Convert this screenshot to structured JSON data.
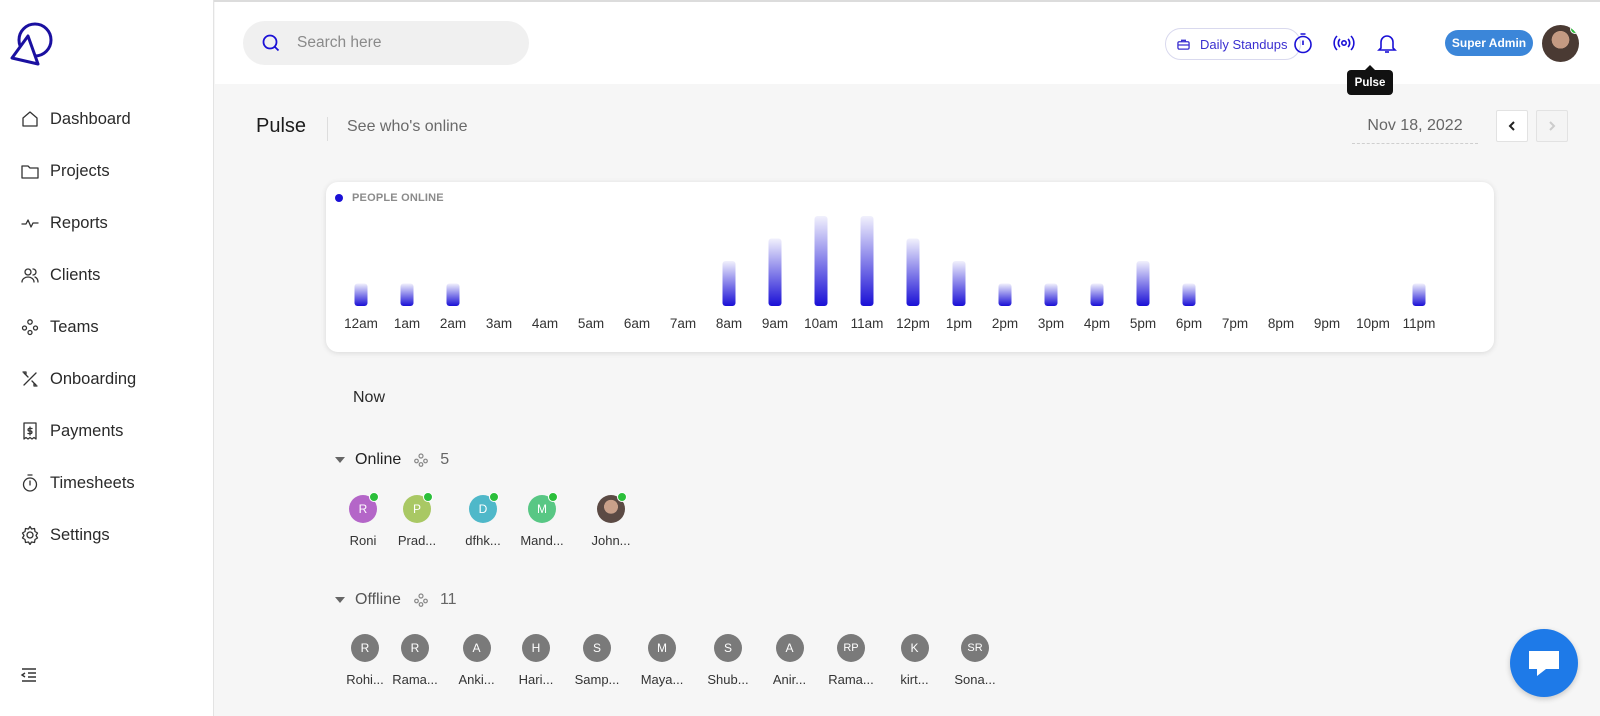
{
  "sidebar": {
    "items": [
      {
        "label": "Dashboard",
        "icon": "home-icon"
      },
      {
        "label": "Projects",
        "icon": "folder-icon"
      },
      {
        "label": "Reports",
        "icon": "activity-icon"
      },
      {
        "label": "Clients",
        "icon": "users-icon"
      },
      {
        "label": "Teams",
        "icon": "team-icon"
      },
      {
        "label": "Onboarding",
        "icon": "tools-icon"
      },
      {
        "label": "Payments",
        "icon": "invoice-icon"
      },
      {
        "label": "Timesheets",
        "icon": "stopwatch-icon"
      },
      {
        "label": "Settings",
        "icon": "gear-icon"
      }
    ]
  },
  "header": {
    "search_placeholder": "Search here",
    "standups_label": "Daily Standups",
    "tooltip": "Pulse",
    "role_badge": "Super Admin"
  },
  "page": {
    "title": "Pulse",
    "subtitle": "See who's online",
    "date": "Nov 18, 2022"
  },
  "colors": {
    "accent": "#1a10d6",
    "badge": "#3b86d9",
    "online": "#2bbf3a",
    "chat": "#1e7ae8"
  },
  "chart_data": {
    "type": "bar",
    "title": "PEOPLE ONLINE",
    "categories": [
      "12am",
      "1am",
      "2am",
      "3am",
      "4am",
      "5am",
      "6am",
      "7am",
      "8am",
      "9am",
      "10am",
      "11am",
      "12pm",
      "1pm",
      "2pm",
      "3pm",
      "4pm",
      "5pm",
      "6pm",
      "7pm",
      "8pm",
      "9pm",
      "10pm",
      "11pm"
    ],
    "values": [
      1,
      1,
      1,
      0,
      0,
      0,
      0,
      0,
      2,
      3,
      4,
      4,
      3,
      2,
      1,
      1,
      1,
      2,
      1,
      0,
      0,
      0,
      0,
      1
    ],
    "ylim": [
      0,
      4
    ],
    "grid": false
  },
  "now_label": "Now",
  "online": {
    "label": "Online",
    "count": "5",
    "people": [
      {
        "initial": "R",
        "name": "Roni",
        "color": "#b466c8"
      },
      {
        "initial": "P",
        "name": "Prad...",
        "color": "#a9c864"
      },
      {
        "initial": "D",
        "name": "dfhk...",
        "color": "#4fb8c9"
      },
      {
        "initial": "M",
        "name": "Mand...",
        "color": "#58c784"
      },
      {
        "initial": "",
        "name": "John...",
        "color": "#5b4a44"
      }
    ]
  },
  "offline": {
    "label": "Offline",
    "count": "11",
    "people": [
      {
        "initial": "R",
        "name": "Rohi..."
      },
      {
        "initial": "R",
        "name": "Rama..."
      },
      {
        "initial": "A",
        "name": "Anki..."
      },
      {
        "initial": "H",
        "name": "Hari..."
      },
      {
        "initial": "S",
        "name": "Samp..."
      },
      {
        "initial": "M",
        "name": "Maya..."
      },
      {
        "initial": "S",
        "name": "Shub..."
      },
      {
        "initial": "A",
        "name": "Anir..."
      },
      {
        "initial": "RP",
        "name": "Rama..."
      },
      {
        "initial": "K",
        "name": "kirt..."
      },
      {
        "initial": "SR",
        "name": "Sona..."
      }
    ]
  }
}
